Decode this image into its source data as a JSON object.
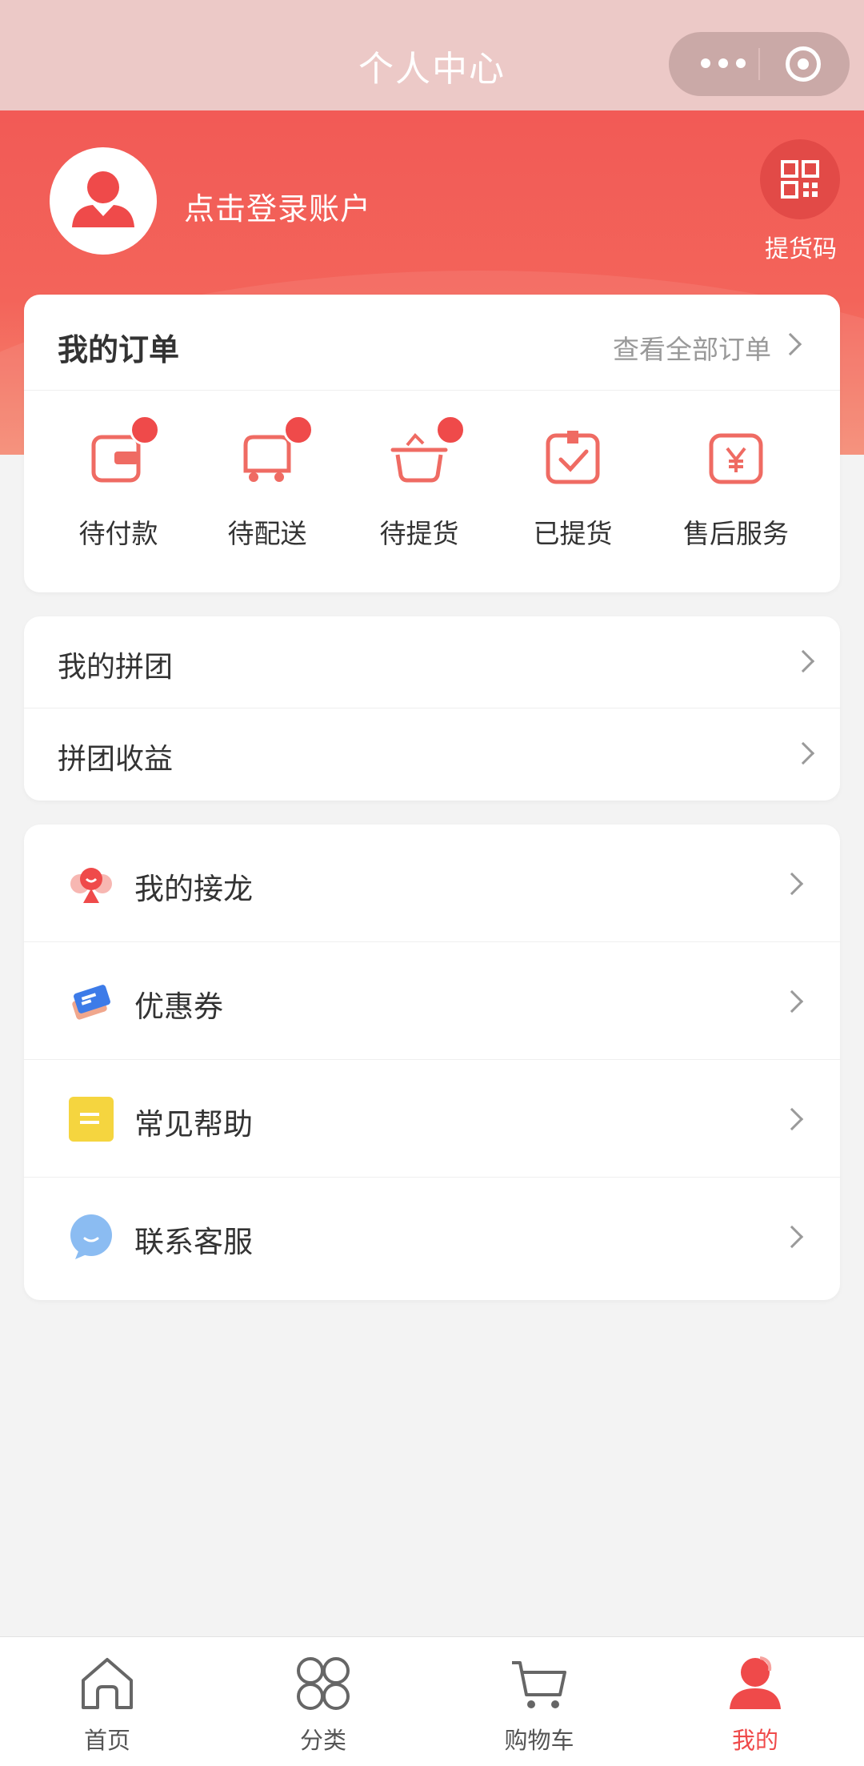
{
  "nav": {
    "title": "个人中心"
  },
  "header": {
    "login_text": "点击登录账户",
    "qr_label": "提货码"
  },
  "orders": {
    "title": "我的订单",
    "view_all": "查看全部订单",
    "items": [
      {
        "label": "待付款",
        "icon": "wallet-icon",
        "badge": true
      },
      {
        "label": "待配送",
        "icon": "delivery-truck-icon",
        "badge": true
      },
      {
        "label": "待提货",
        "icon": "basket-icon",
        "badge": true
      },
      {
        "label": "已提货",
        "icon": "received-box-icon",
        "badge": false
      },
      {
        "label": "售后服务",
        "icon": "after-sales-yen-icon",
        "badge": false
      }
    ]
  },
  "group": {
    "items": [
      {
        "label": "我的拼团"
      },
      {
        "label": "拼团收益"
      }
    ]
  },
  "list": {
    "items": [
      {
        "label": "我的接龙",
        "icon": "relay-icon"
      },
      {
        "label": "优惠券",
        "icon": "coupon-icon"
      },
      {
        "label": "常见帮助",
        "icon": "help-note-icon"
      },
      {
        "label": "联系客服",
        "icon": "chat-bubble-icon"
      }
    ]
  },
  "tabbar": {
    "items": [
      {
        "label": "首页",
        "icon": "home-icon"
      },
      {
        "label": "分类",
        "icon": "category-icon"
      },
      {
        "label": "购物车",
        "icon": "cart-icon"
      },
      {
        "label": "我的",
        "icon": "user-icon",
        "active": true
      }
    ]
  },
  "colors": {
    "accent": "#ef4a4a",
    "header": "#f25a56",
    "navbar": "#ecc9c7",
    "background": "#f3f3f3"
  }
}
